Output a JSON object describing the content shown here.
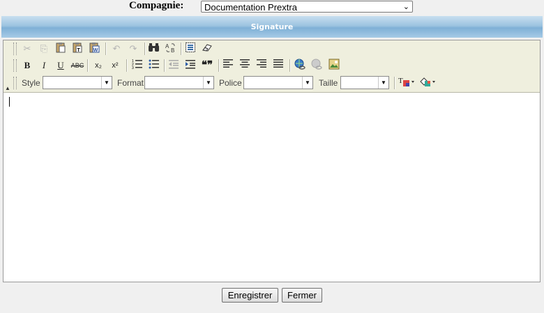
{
  "company": {
    "label": "Compagnie:",
    "selected": "Documentation Prextra"
  },
  "section": {
    "title": "Signature"
  },
  "toolbar": {
    "row1": [
      "cut-icon",
      "copy-icon",
      "paste-icon",
      "paste-text-icon",
      "paste-word-icon",
      "undo-icon",
      "redo-icon",
      "find-icon",
      "replace-icon",
      "select-all-icon",
      "remove-format-icon"
    ],
    "row2": {
      "bold": "B",
      "italic": "I",
      "underline": "U",
      "strike": "ABC",
      "subscript": "x₂",
      "superscript": "x²",
      "blockquote": "❝❞"
    },
    "row3": {
      "style_label": "Style",
      "format_label": "Format",
      "font_label": "Police",
      "size_label": "Taille"
    }
  },
  "editor": {
    "content": ""
  },
  "buttons": {
    "save": "Enregistrer",
    "close": "Fermer"
  }
}
